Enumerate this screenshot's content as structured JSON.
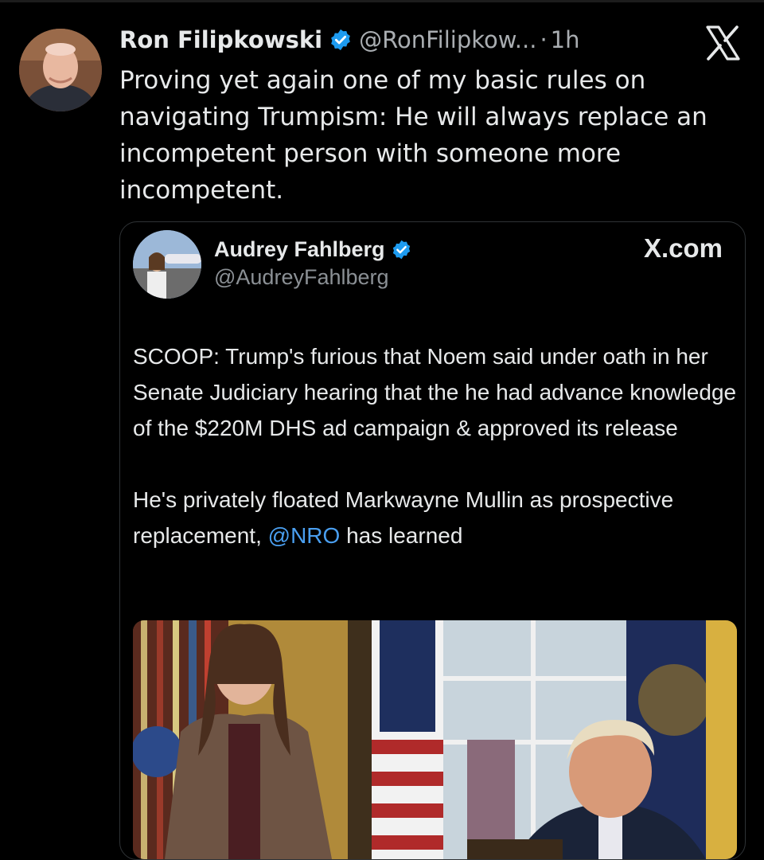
{
  "tweet": {
    "author_name": "Ron Filipkowski",
    "handle": "@RonFilipkow...",
    "separator": "·",
    "time": "1h",
    "text": "Proving yet again one of my basic rules on navigating Trumpism: He will always replace an incompetent person with someone more incompetent.",
    "verified_icon": "verified-badge-icon",
    "avatar_icon": "profile-avatar"
  },
  "platform_logo": "x-logo-icon",
  "quote": {
    "author_name": "Audrey Fahlberg",
    "handle": "@AudreyFahlberg",
    "site_label": "X.com",
    "paragraph1": "SCOOP: Trump's furious that Noem said under oath in her Senate Judiciary hearing that the he had advance knowledge of the $220M DHS ad campaign & approved its release",
    "paragraph2_before": "He's privately floated Markwayne Mullin as prospective replacement, ",
    "mention": "@NRO",
    "paragraph2_after": " has learned",
    "photo_icon": "news-photo"
  },
  "colors": {
    "background": "#000000",
    "text": "#e7e9ea",
    "secondary_text": "#a9adb1",
    "verified_blue": "#1d9bf0",
    "mention_blue": "#4a9ff0",
    "border": "#2f3336"
  }
}
